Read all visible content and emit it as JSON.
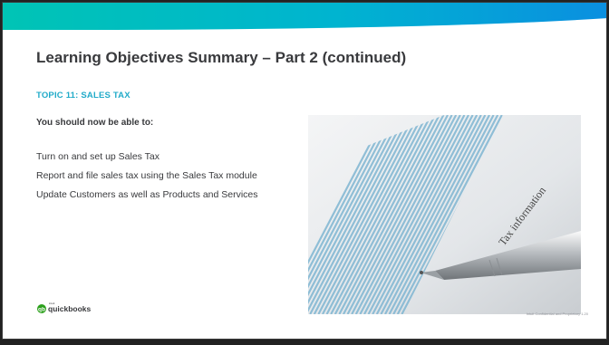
{
  "slide": {
    "title_bold": "Learning Objectives Summary – Part 2",
    "title_rest": " (continued)",
    "topic": "TOPIC 11: SALES TAX",
    "lead": "You should now be able to:",
    "objectives": [
      "Turn on and set up Sales Tax",
      "Report and file sales tax using the Sales Tax module",
      "Update Customers as well as Products and Services"
    ],
    "photo_text": "Tax information",
    "brand": {
      "small": "intuit",
      "word": "quickbooks"
    },
    "footer": "Intuit Confidential and Proprietary   1.20"
  },
  "colors": {
    "band_teal": "#00c1bf",
    "band_blue": "#0097e6",
    "topic": "#21abc9",
    "text": "#393a3d",
    "logo_green": "#2ca01c"
  }
}
